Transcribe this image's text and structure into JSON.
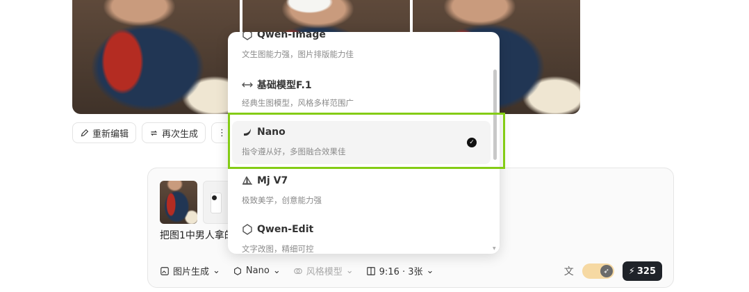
{
  "actions": {
    "edit_label": "重新编辑",
    "regenerate_label": "再次生成",
    "more_label": "⋮"
  },
  "composer": {
    "prompt": "把图1中男人拿的",
    "toolbar": [
      {
        "label": "图片生成",
        "icon": "image-icon"
      },
      {
        "label": "Nano",
        "icon": "cube-icon"
      },
      {
        "label": "风格模型",
        "icon": "style-icon",
        "disabled": true
      },
      {
        "label": "9:16 · 3张",
        "icon": "ratio-icon"
      }
    ],
    "credits": "325"
  },
  "dropdown": {
    "options": [
      {
        "name": "Qwen-Image",
        "desc": "文生图能力强，图片排版能力佳",
        "icon": "qwen-icon"
      },
      {
        "name": "基础模型F.1",
        "desc": "经典生图模型，风格多样范围广",
        "icon": "base-model-icon"
      },
      {
        "name": "Nano",
        "desc": "指令遵从好，多图融合效果佳",
        "icon": "banana-icon",
        "selected": true
      },
      {
        "name": "Mj V7",
        "desc": "极致美学，创意能力强",
        "icon": "sailboat-icon"
      },
      {
        "name": "Qwen-Edit",
        "desc": "文字改图，精细可控",
        "icon": "qwen-icon"
      }
    ]
  },
  "colors": {
    "highlight": "#84cc16",
    "credits_bg": "#1f2329",
    "toggle_bg": "#f6d9a3"
  }
}
